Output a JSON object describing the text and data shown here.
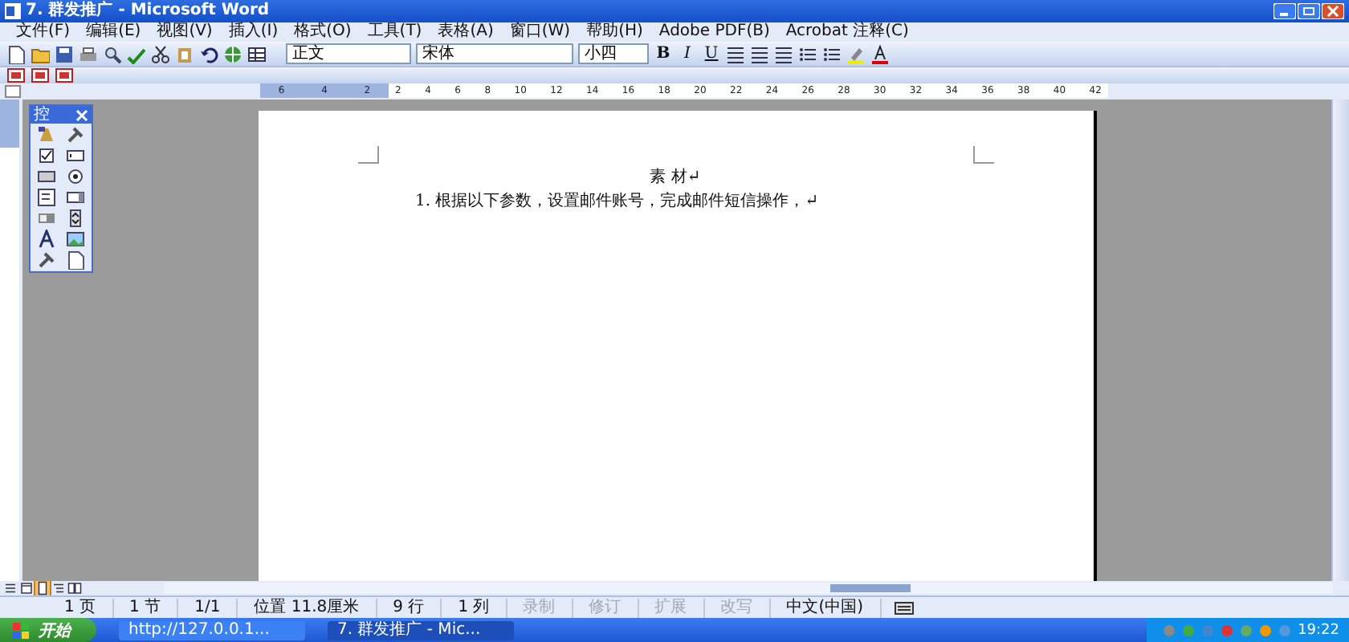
{
  "window": {
    "title": "7. 群发推广 - Microsoft Word"
  },
  "menu": [
    "文件(F)",
    "编辑(E)",
    "视图(V)",
    "插入(I)",
    "格式(O)",
    "工具(T)",
    "表格(A)",
    "窗口(W)",
    "帮助(H)",
    "Adobe PDF(B)",
    "Acrobat 注释(C)"
  ],
  "formatting": {
    "style": "正文",
    "font": "宋体",
    "size": "小四",
    "bold": "B",
    "italic": "I",
    "underline": "U"
  },
  "ruler": {
    "left_ticks": [
      "6",
      "4",
      "2"
    ],
    "right_ticks": [
      "2",
      "4",
      "6",
      "8",
      "10",
      "12",
      "14",
      "16",
      "18",
      "20",
      "22",
      "24",
      "26",
      "28",
      "30",
      "32",
      "34",
      "36",
      "38",
      "40",
      "42"
    ]
  },
  "toolbox": {
    "title": "控"
  },
  "document": {
    "title": "素 材↵",
    "paragraphs": [
      "1. 根据以下参数，设置邮件账号，完成邮件短信操作，↵"
    ]
  },
  "view_buttons": [
    {
      "selected": false
    },
    {
      "selected": false
    },
    {
      "selected": true
    },
    {
      "selected": false
    },
    {
      "selected": false
    }
  ],
  "status_bar": [
    {
      "text": "1 页",
      "disabled": false
    },
    {
      "text": "1 节",
      "disabled": false
    },
    {
      "text": "1/1",
      "disabled": false
    },
    {
      "text": "位置 11.8厘米",
      "disabled": false
    },
    {
      "text": "9 行",
      "disabled": false
    },
    {
      "text": "1 列",
      "disabled": false
    },
    {
      "text": "录制",
      "disabled": true
    },
    {
      "text": "修订",
      "disabled": true
    },
    {
      "text": "扩展",
      "disabled": true
    },
    {
      "text": "改写",
      "disabled": true
    },
    {
      "text": "中文(中国)",
      "disabled": false
    }
  ],
  "taskbar": {
    "start": "开始",
    "tasks": [
      {
        "label": "http://127.0.0.1...",
        "selected": false
      },
      {
        "label": "7. 群发推广 - Mic...",
        "selected": true
      }
    ],
    "clock": "19:22"
  }
}
